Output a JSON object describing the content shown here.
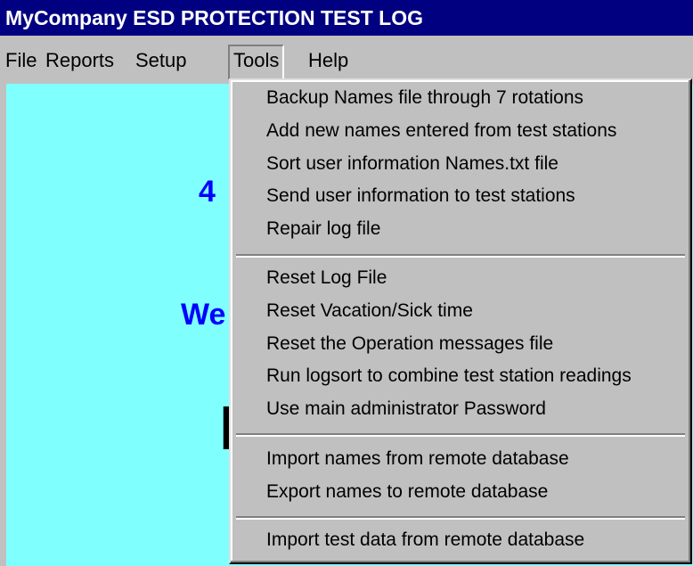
{
  "window": {
    "title": "MyCompany ESD PROTECTION TEST LOG"
  },
  "menubar": {
    "items": [
      {
        "label": "File"
      },
      {
        "label": "Reports"
      },
      {
        "label": "Setup"
      },
      {
        "label": "Tools"
      },
      {
        "label": "Help"
      }
    ],
    "open_menu": "Tools"
  },
  "client": {
    "background": "#80ffff",
    "visible_fragments": [
      {
        "text": "4",
        "color": "#0000ff"
      },
      {
        "text": "We",
        "color": "#0000ff"
      },
      {
        "text": "F",
        "color": "#000000"
      }
    ]
  },
  "tools_menu": {
    "groups": [
      [
        "Backup Names file through 7 rotations",
        "Add new names entered from test stations",
        "Sort user information Names.txt file",
        "Send user information to test stations",
        "Repair log file"
      ],
      [
        "Reset Log File",
        "Reset Vacation/Sick time",
        "Reset the Operation messages file",
        "Run logsort to combine test station readings",
        "Use main administrator Password"
      ],
      [
        "Import names from remote database",
        "Export names to remote database"
      ],
      [
        "Import test data from remote database"
      ]
    ]
  },
  "colors": {
    "title_bar": "#000080",
    "menu_face": "#c0c0c0"
  }
}
